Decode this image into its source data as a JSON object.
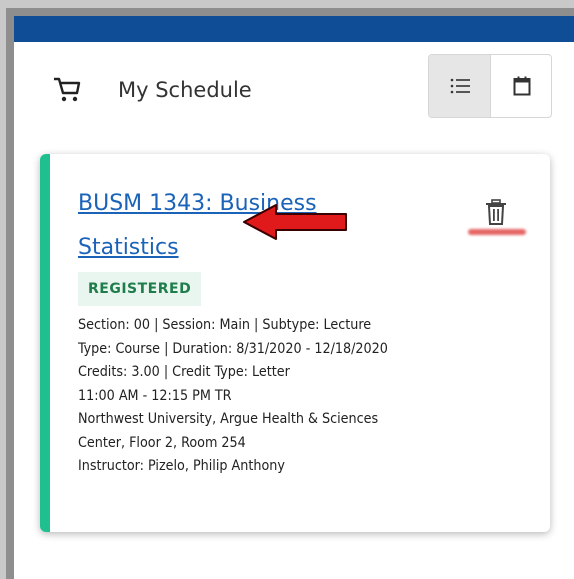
{
  "header": {
    "title": "My Schedule",
    "cart_icon": "cart-icon",
    "view_toggle": [
      {
        "icon": "list-icon",
        "active": true
      },
      {
        "icon": "calendar-icon",
        "active": false
      }
    ]
  },
  "colors": {
    "topbar": "#0f4e96",
    "accent": "#1fbf8f",
    "link": "#1b63b8",
    "badge_bg": "#e8f6ef",
    "badge_text": "#1e7d4b",
    "annotation_red": "#e01a1a"
  },
  "card": {
    "course_title": "BUSM 1343: Business Statistics",
    "status_badge": "REGISTERED",
    "details": [
      "Section: 00 | Session: Main | Subtype: Lecture",
      "Type: Course | Duration: 8/31/2020 - 12/18/2020",
      "Credits: 3.00 | Credit Type: Letter",
      "11:00 AM - 12:15 PM TR",
      "Northwest University, Argue Health & Sciences",
      "Center, Floor 2, Room 254",
      "Instructor: Pizelo, Philip Anthony"
    ],
    "delete_icon": "trash-icon"
  },
  "annotation": {
    "arrow_icon": "red-arrow-icon"
  }
}
